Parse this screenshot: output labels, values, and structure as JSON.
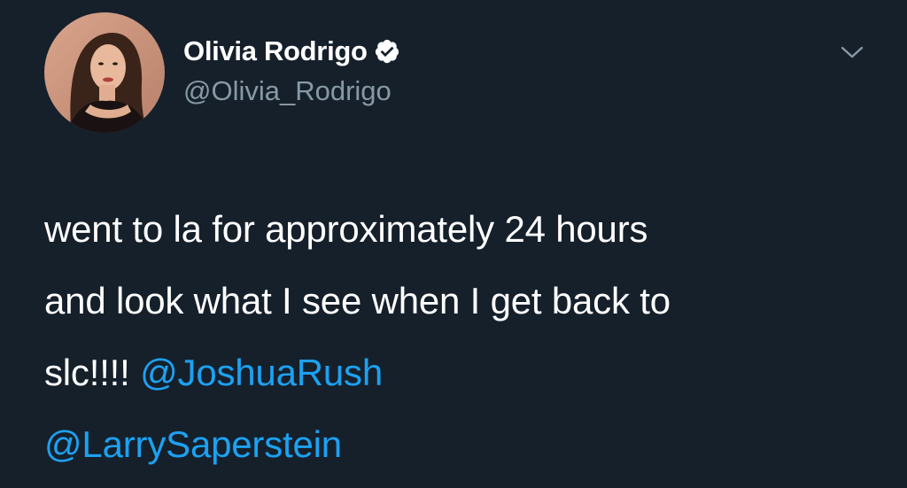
{
  "tweet": {
    "author": {
      "display_name": "Olivia Rodrigo",
      "handle": "@Olivia_Rodrigo",
      "verified": true,
      "avatar_icon": "profile-photo"
    },
    "menu_icon": "chevron-down-icon",
    "text": {
      "line1": "went to la for approximately 24 hours",
      "line2": "and look what I see when I get back to",
      "line3_prefix": "slc!!!! ",
      "mention1": "@JoshuaRush",
      "mention2": "@LarrySaperstein"
    }
  },
  "colors": {
    "background": "#15202b",
    "primary_text": "#ffffff",
    "secondary_text": "#8899a6",
    "link": "#1da1f2"
  }
}
